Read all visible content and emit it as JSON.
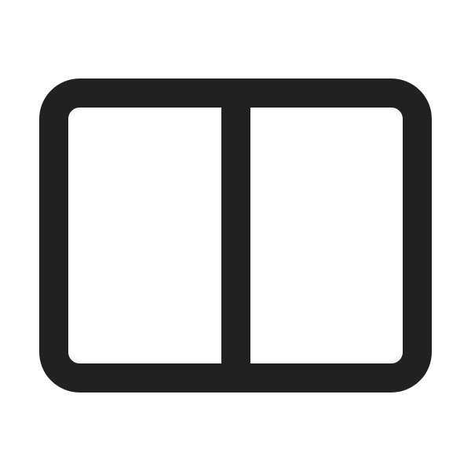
{
  "icon": {
    "name": "split-view-icon",
    "color": "#212121",
    "background": "#ffffff"
  }
}
